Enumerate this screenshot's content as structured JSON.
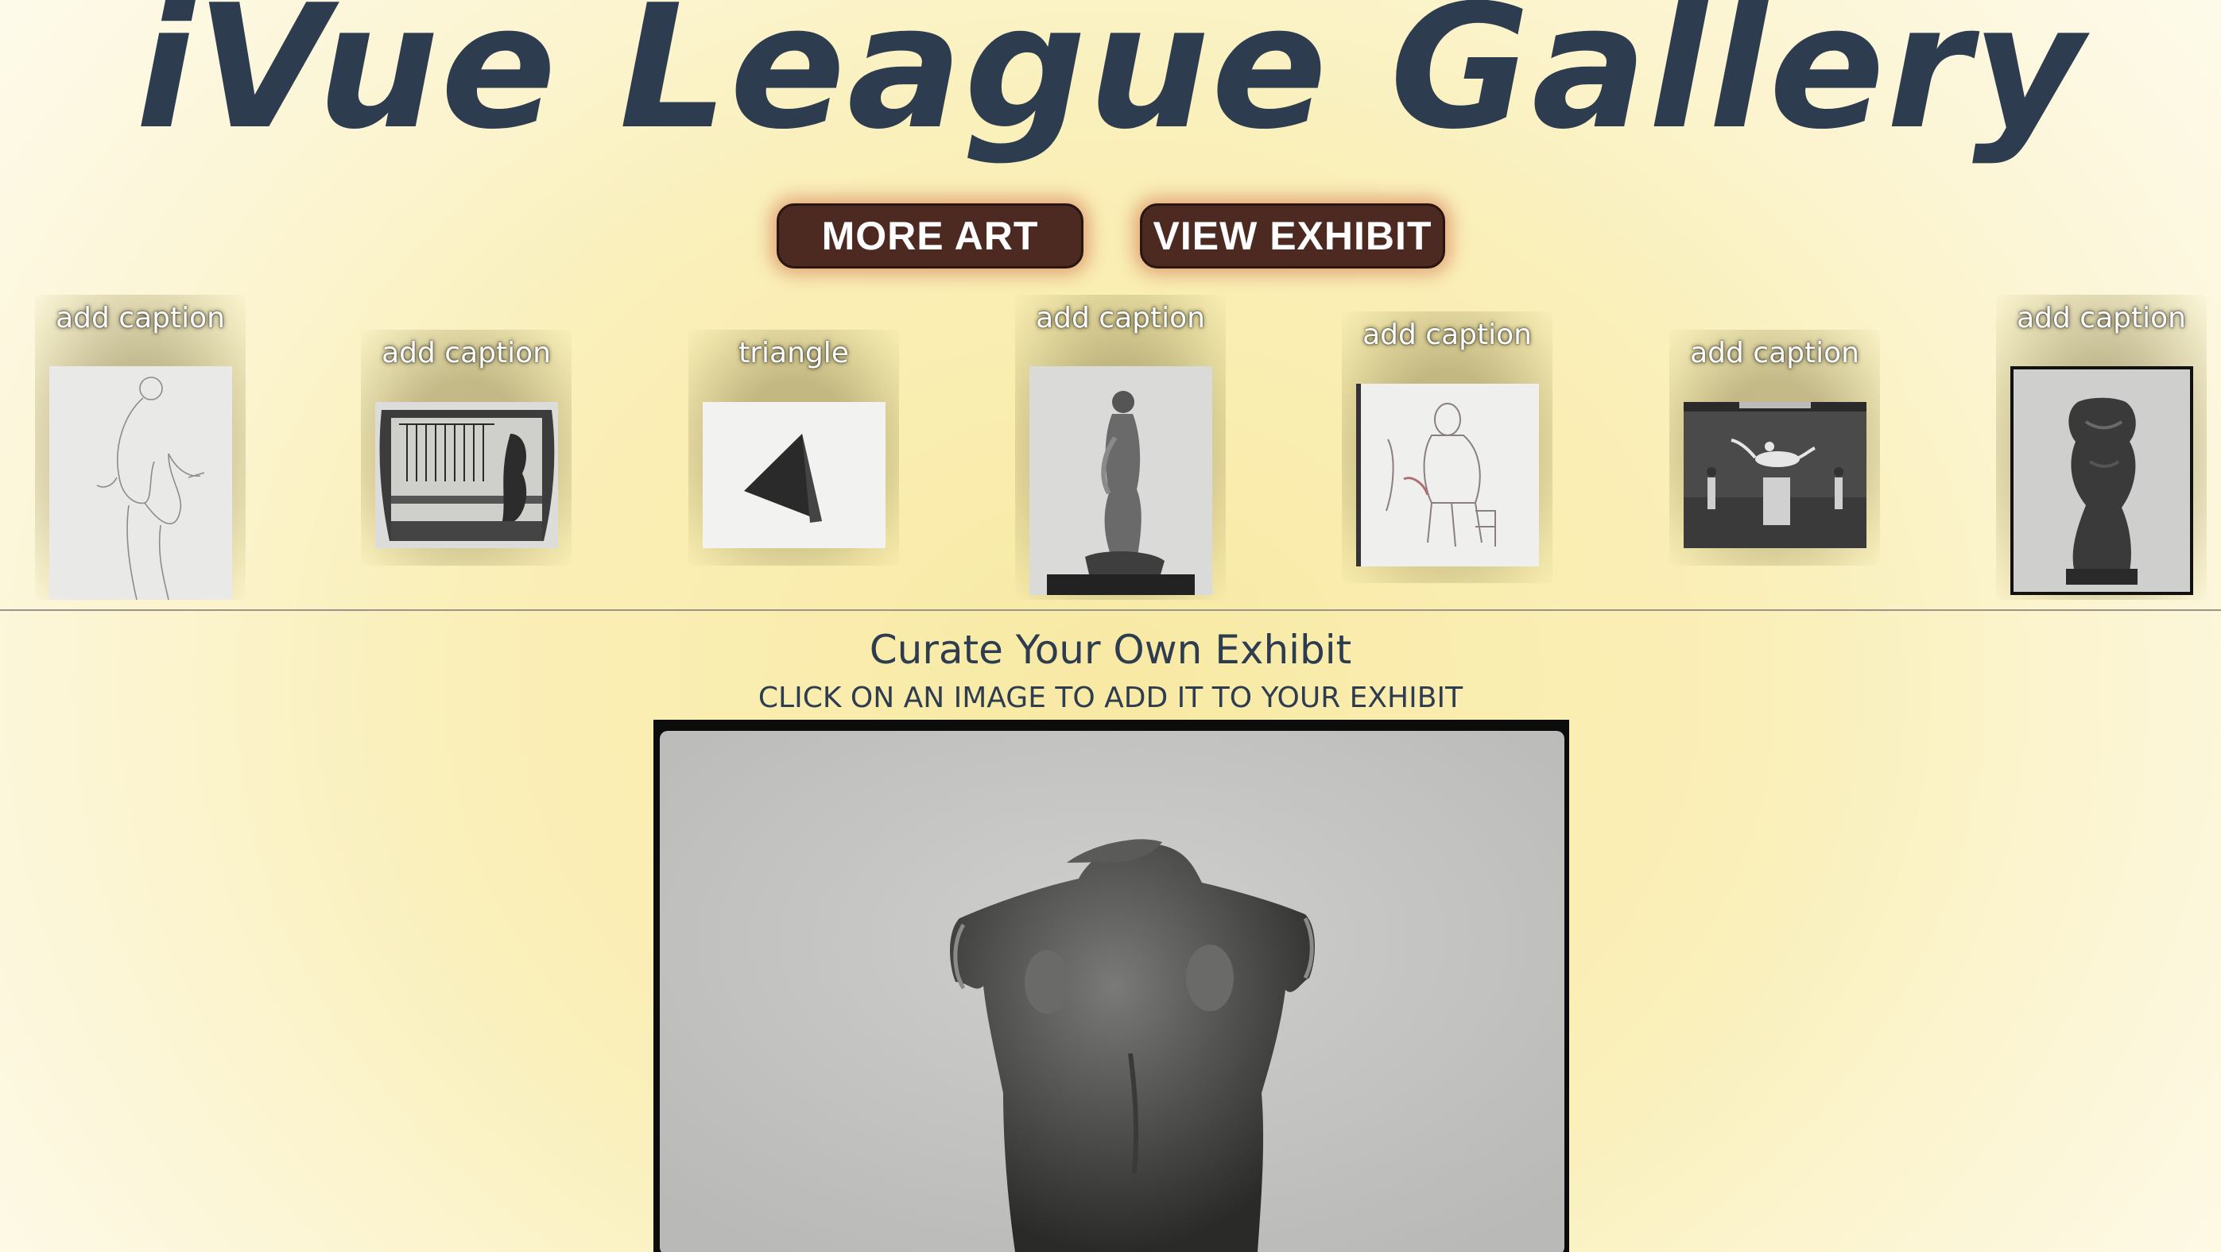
{
  "header": {
    "title": "iVue League Gallery"
  },
  "toolbar": {
    "more_art_label": "MORE ART",
    "view_exhibit_label": "VIEW EXHIBIT"
  },
  "gallery": {
    "items": [
      {
        "caption": "add caption",
        "image": "pencil-sketch-figure"
      },
      {
        "caption": "add caption",
        "image": "greek-vase"
      },
      {
        "caption": "triangle",
        "image": "dark-triangle-sculpture"
      },
      {
        "caption": "add caption",
        "image": "bronze-standing-figure"
      },
      {
        "caption": "add caption",
        "image": "seated-figure-sketch"
      },
      {
        "caption": "add caption",
        "image": "gallery-room-sculpture"
      },
      {
        "caption": "add caption",
        "image": "bronze-torso"
      }
    ]
  },
  "exhibit": {
    "title": "Curate Your Own Exhibit",
    "instruction": "CLICK ON AN IMAGE TO ADD IT TO YOUR EXHIBIT",
    "selected_image": "bronze-torso-large"
  },
  "colors": {
    "title_text": "#2e3c50",
    "button_bg": "#4c2a22",
    "button_glow": "#c85532",
    "background": "#f8eaa4"
  }
}
